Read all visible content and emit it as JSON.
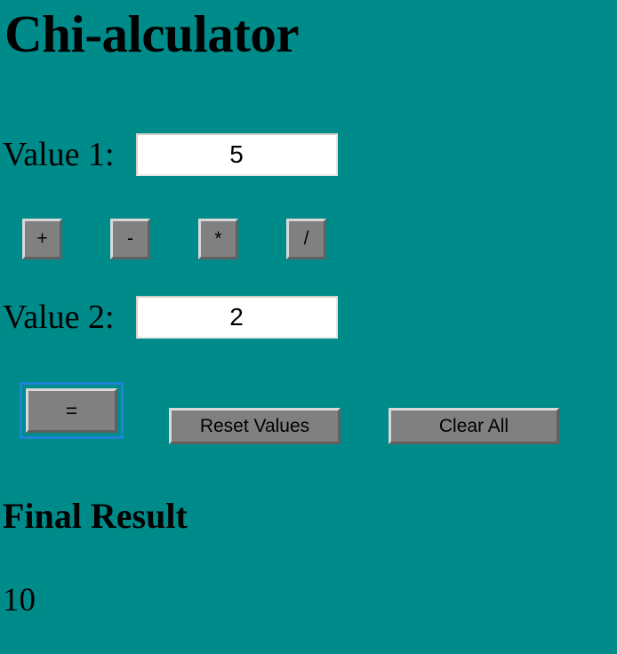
{
  "theme": {
    "background_color": "#008B8B",
    "button_face_color": "#808080",
    "button_text_color": "#000000",
    "focus_ring_color": "#1a84d6",
    "input_background_color": "#FFFFFF",
    "text_color": "#000000"
  },
  "header": {
    "title": "Chi-alculator"
  },
  "form": {
    "value1": {
      "label": "Value 1:",
      "value": "5",
      "placeholder": ""
    },
    "value2": {
      "label": "Value 2:",
      "value": "2",
      "placeholder": ""
    }
  },
  "operators": [
    {
      "id": "add",
      "label": "+",
      "icon": "plus-icon"
    },
    {
      "id": "subtract",
      "label": "-",
      "icon": "minus-icon"
    },
    {
      "id": "multiply",
      "label": "*",
      "icon": "asterisk-icon"
    },
    {
      "id": "divide",
      "label": "/",
      "icon": "slash-icon"
    }
  ],
  "actions": {
    "equals": {
      "label": "=",
      "focused": true
    },
    "reset": {
      "label": "Reset Values"
    },
    "clear": {
      "label": "Clear All"
    }
  },
  "result": {
    "heading": "Final Result",
    "value": "10"
  }
}
